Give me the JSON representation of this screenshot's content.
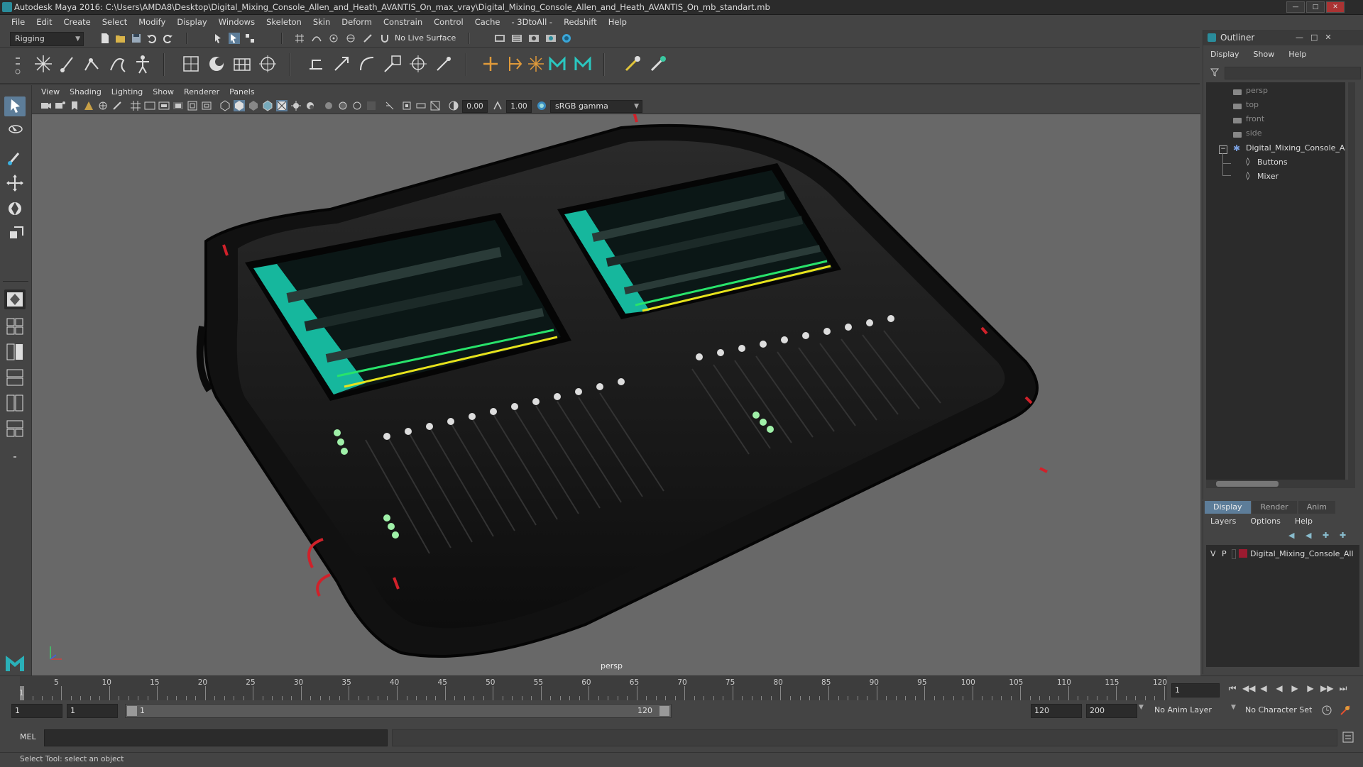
{
  "window": {
    "title": "Autodesk Maya 2016: C:\\Users\\AMDA8\\Desktop\\Digital_Mixing_Console_Allen_and_Heath_AVANTIS_On_max_vray\\Digital_Mixing_Console_Allen_and_Heath_AVANTIS_On_mb_standart.mb"
  },
  "menubar": [
    "File",
    "Edit",
    "Create",
    "Select",
    "Modify",
    "Display",
    "Windows",
    "Skeleton",
    "Skin",
    "Deform",
    "Constrain",
    "Control",
    "Cache",
    "- 3DtoAll -",
    "Redshift",
    "Help"
  ],
  "statusline": {
    "menu_set": "Rigging",
    "live_surface": "No Live Surface"
  },
  "viewport": {
    "menus": [
      "View",
      "Shading",
      "Lighting",
      "Show",
      "Renderer",
      "Panels"
    ],
    "exposure": "0.00",
    "gamma": "1.00",
    "color_space": "sRGB gamma",
    "camera": "persp"
  },
  "outliner": {
    "title": "Outliner",
    "menus": [
      "Display",
      "Show",
      "Help"
    ],
    "items": [
      {
        "label": "persp",
        "kind": "camera"
      },
      {
        "label": "top",
        "kind": "camera"
      },
      {
        "label": "front",
        "kind": "camera"
      },
      {
        "label": "side",
        "kind": "camera"
      },
      {
        "label": "Digital_Mixing_Console_A",
        "kind": "group"
      },
      {
        "label": "Buttons",
        "kind": "mesh"
      },
      {
        "label": "Mixer",
        "kind": "mesh"
      }
    ]
  },
  "layer_editor": {
    "tabs": [
      "Display",
      "Render",
      "Anim"
    ],
    "active_tab": "Display",
    "menus": [
      "Layers",
      "Options",
      "Help"
    ],
    "layer": {
      "v": "V",
      "p": "P",
      "name": "Digital_Mixing_Console_All",
      "color": "#9b1b30"
    }
  },
  "timeline": {
    "ticks": [
      "5",
      "10",
      "15",
      "20",
      "25",
      "30",
      "35",
      "40",
      "45",
      "50",
      "55",
      "60",
      "65",
      "70",
      "75",
      "80",
      "85",
      "90",
      "95",
      "100",
      "105",
      "110",
      "115",
      "120"
    ],
    "start_marker": "1",
    "current_frame": "1"
  },
  "range": {
    "start": "1",
    "playback_start": "1",
    "slider_start": "1",
    "slider_end": "120",
    "playback_end": "120",
    "end": "200",
    "anim_layer": "No Anim Layer",
    "character_set": "No Character Set"
  },
  "commandline": {
    "language": "MEL"
  },
  "helpline": {
    "text": "Select Tool: select an object"
  },
  "colors": {
    "accent": "#5d7d99",
    "screen_cyan": "#19d3b5",
    "led_green": "#28e36b",
    "led_yellow": "#e7e31c",
    "rim_red": "#d0212a"
  }
}
